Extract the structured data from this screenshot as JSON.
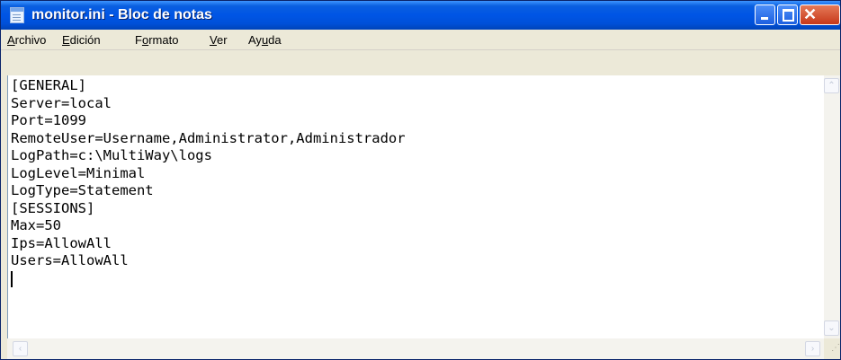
{
  "window": {
    "title": "monitor.ini - Bloc de notas",
    "icon": "notepad-icon",
    "controls": {
      "minimize": "minimize-icon",
      "maximize": "maximize-icon",
      "close": "close-icon",
      "close_glyph": "✕"
    }
  },
  "menu": [
    {
      "mnemonic": "A",
      "rest": "rchivo"
    },
    {
      "mnemonic": "E",
      "rest": "dición"
    },
    {
      "pre": "F",
      "mnemonic": "o",
      "rest": "rmato"
    },
    {
      "mnemonic": "V",
      "rest": "er"
    },
    {
      "pre": "Ay",
      "mnemonic": "u",
      "rest": "da"
    }
  ],
  "editor": {
    "lines": [
      "[GENERAL]",
      "Server=local",
      "Port=1099",
      "RemoteUser=Username,Administrator,Administrador",
      "LogPath=c:\\MultiWay\\logs",
      "LogLevel=Minimal",
      "LogType=Statement",
      "[SESSIONS]",
      "Max=50",
      "Ips=AllowAll",
      "Users=AllowAll"
    ]
  },
  "scrollbars": {
    "up_arrow": "⌃",
    "down_arrow": "⌄",
    "left_arrow": "‹",
    "right_arrow": "›",
    "grip": "⋰"
  },
  "colors": {
    "titlebar": "#0055e5",
    "close_button": "#c7381a",
    "chrome": "#ece9d8"
  }
}
